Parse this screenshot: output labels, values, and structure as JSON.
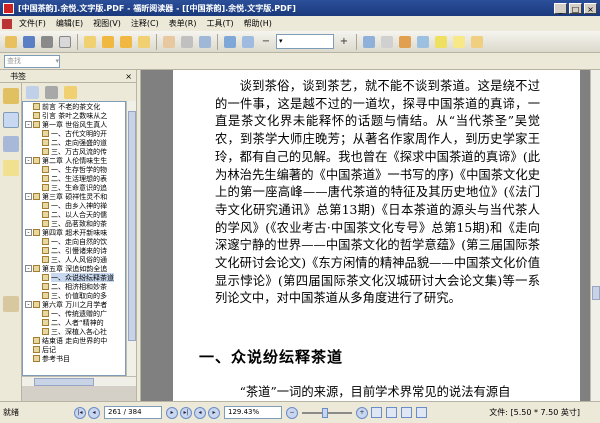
{
  "window": {
    "title": "[中国茶韵].余悦.文字版.PDF - 福昕阅读器 - [[中国茶韵].余悦.文字版.PDF]",
    "controls": [
      "_",
      "□",
      "×"
    ]
  },
  "menu": {
    "items": [
      "文件(F)",
      "编辑(E)",
      "视图(V)",
      "注释(C)",
      "表单(R)",
      "工具(T)",
      "帮助(H)"
    ]
  },
  "toolbar": {
    "zoom_label": "▾"
  },
  "find": {
    "placeholder": "查找",
    "dropdown": "▾"
  },
  "bookmarks": {
    "panel_title": "书签",
    "close_glyph": "×",
    "items": [
      {
        "indent": 0,
        "expander": "",
        "label": "前言 不老的茶文化"
      },
      {
        "indent": 0,
        "expander": "",
        "label": "引言 茶叶之数味从之"
      },
      {
        "indent": 0,
        "expander": "-",
        "label": "第一章 世俗风生真人"
      },
      {
        "indent": 1,
        "expander": "",
        "label": "一、古代文明的开"
      },
      {
        "indent": 1,
        "expander": "",
        "label": "二、走向强盛的道"
      },
      {
        "indent": 1,
        "expander": "",
        "label": "三、万古风流的传"
      },
      {
        "indent": 0,
        "expander": "-",
        "label": "第二章 人伦情味生生"
      },
      {
        "indent": 1,
        "expander": "",
        "label": "一、生存哲学的物"
      },
      {
        "indent": 1,
        "expander": "",
        "label": "二、生活理想的表"
      },
      {
        "indent": 1,
        "expander": "",
        "label": "三、生命意识的追"
      },
      {
        "indent": 0,
        "expander": "-",
        "label": "第三章 硕祥性灵不和"
      },
      {
        "indent": 1,
        "expander": "",
        "label": "一、由乡入神的禅"
      },
      {
        "indent": 1,
        "expander": "",
        "label": "二、以人合天的儒"
      },
      {
        "indent": 1,
        "expander": "",
        "label": "三、品茗致和的茶"
      },
      {
        "indent": 0,
        "expander": "-",
        "label": "第四章 超术开新味味"
      },
      {
        "indent": 1,
        "expander": "",
        "label": "一、走向自然的饮"
      },
      {
        "indent": 1,
        "expander": "",
        "label": "二、引慢诸来的诗"
      },
      {
        "indent": 1,
        "expander": "",
        "label": "三、人人风俗的通"
      },
      {
        "indent": 0,
        "expander": "-",
        "label": "第五章 深追如韵全追"
      },
      {
        "indent": 1,
        "expander": "",
        "label": "一、众说纷纭释茶道",
        "selected": true
      },
      {
        "indent": 1,
        "expander": "",
        "label": "二、相济相和妙茶"
      },
      {
        "indent": 1,
        "expander": "",
        "label": "三、价值取向的多"
      },
      {
        "indent": 0,
        "expander": "-",
        "label": "第六章 万川之月学者"
      },
      {
        "indent": 1,
        "expander": "",
        "label": "一、传统遗赠的广"
      },
      {
        "indent": 1,
        "expander": "",
        "label": "二、人者“精神的"
      },
      {
        "indent": 1,
        "expander": "",
        "label": "三、深植入各心社"
      },
      {
        "indent": 0,
        "expander": "",
        "label": "结束语 走向世界的中"
      },
      {
        "indent": 0,
        "expander": "",
        "label": "后记"
      },
      {
        "indent": 0,
        "expander": "",
        "label": "参考书目"
      }
    ]
  },
  "document": {
    "paragraph_1": "谈到茶俗，谈到茶艺，就不能不谈到茶道。这是绕不过的一件事，这是越不过的一道坎，探寻中国茶道的真谛，一直是茶文化界未能释怀的话题与情结。从“当代茶圣”吴觉农，到茶学大师庄晚芳；从著名作家周作人，到历史学家王玲，都有自己的见解。我也曾在《探求中国茶道的真谛》(此为林治先生编著的《中国茶道》一书写的序)《中国茶文化史上的第一座高峰——唐代茶道的特征及其历史地位》(《法门寺文化研究通讯》总第13期)《日本茶道的源头与当代茶人的学风》(《农业考古·中国茶文化专号》总第15期)和《走向深邃宁静的世界——中国茶文化的哲学意蕴》(第三届国际茶文化研讨会论文)《东方闲情的精神品貌——中国茶文化价值显示悖论》(第四届国际茶文化汉城研讨大会论文集)等一系列论文中，对中国茶道从多角度进行了研究。",
    "section_heading": "一、众说纷纭释茶道",
    "paragraph_2": "“茶道”一词的来源，目前学术界常见的说法有源自"
  },
  "status": {
    "ready": "就绪",
    "page_display": "261 / 384",
    "zoom": "129.43%",
    "page_size": "文件: [5.50 * 7.50 英寸]"
  },
  "colors": {
    "titlebar": "#1a3a7c",
    "chrome": "#ece9d8",
    "doc_background": "#808080",
    "selection": "#c8d8ee"
  }
}
